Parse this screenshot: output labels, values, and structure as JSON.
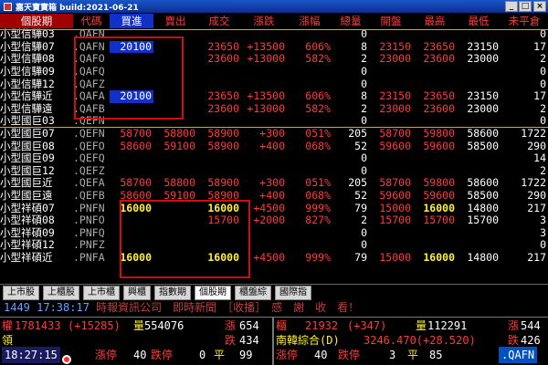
{
  "window": {
    "title": "嘉天寶寶箱 build:2021-06-21",
    "controls": [
      "_",
      "□",
      "×"
    ]
  },
  "colors": {
    "up": "#ff3b3b",
    "header_bg": "#a00000",
    "highlight_box": "#cc1010",
    "text_yellow": "#ffef3a"
  },
  "table": {
    "headers": [
      "個股期",
      "代碼",
      "買進",
      "賣出",
      "成交",
      "漲跌",
      "漲幅",
      "總量",
      "開盤",
      "最高",
      "最低",
      "未平倉"
    ],
    "rows": [
      [
        "小型信驊03",
        ".QAFN",
        "",
        "",
        "",
        "",
        "",
        "0",
        "",
        "",
        "",
        "0"
      ],
      [
        "小型信驊07",
        ".QAFN",
        "20100",
        "",
        "23650",
        "+13500",
        "606%",
        "8",
        "23150",
        "23650",
        "23150",
        "17"
      ],
      [
        "小型信驊08",
        ".QAFO",
        "",
        "",
        "23600",
        "+13000",
        "582%",
        "2",
        "23000",
        "23600",
        "23000",
        "2"
      ],
      [
        "小型信驊09",
        ".QAFQ",
        "",
        "",
        "",
        "",
        "",
        "0",
        "",
        "",
        "",
        "0"
      ],
      [
        "小型信驊12",
        ".QAFZ",
        "",
        "",
        "",
        "",
        "",
        "0",
        "",
        "",
        "",
        "0"
      ],
      [
        "小型信驊近",
        ".QAFA",
        "20100",
        "",
        "23650",
        "+13500",
        "606%",
        "8",
        "23150",
        "23650",
        "23150",
        "17"
      ],
      [
        "小型信驊遠",
        ".QAFB",
        "",
        "",
        "23600",
        "+13000",
        "582%",
        "2",
        "23000",
        "23600",
        "23000",
        "2"
      ],
      [
        "小型國巨03",
        ".QEFN",
        "",
        "",
        "",
        "",
        "",
        "0",
        "",
        "",
        "",
        "0"
      ],
      [
        "小型國巨07",
        ".QEFN",
        "58700",
        "58800",
        "58900",
        "+300",
        "051%",
        "205",
        "58700",
        "59800",
        "58600",
        "1722"
      ],
      [
        "小型國巨08",
        ".QEFO",
        "58600",
        "59100",
        "58900",
        "+400",
        "068%",
        "52",
        "59600",
        "59600",
        "58500",
        "290"
      ],
      [
        "小型國巨09",
        ".QEFQ",
        "",
        "",
        "",
        "",
        "",
        "0",
        "",
        "",
        "",
        "14"
      ],
      [
        "小型國巨12",
        ".QEFZ",
        "",
        "",
        "",
        "",
        "",
        "0",
        "",
        "",
        "",
        "2"
      ],
      [
        "小型國巨近",
        ".QEFA",
        "58700",
        "58800",
        "58900",
        "+300",
        "051%",
        "205",
        "58700",
        "59800",
        "58600",
        "1722"
      ],
      [
        "小型國巨遠",
        ".QEFB",
        "58600",
        "59100",
        "58900",
        "+400",
        "068%",
        "52",
        "59600",
        "59600",
        "58500",
        "290"
      ],
      [
        "小型祥碩07",
        ".PNFN",
        "16000",
        "",
        "16000",
        "+4500",
        "999%",
        "79",
        "15000",
        "16000",
        "14800",
        "217"
      ],
      [
        "小型祥碩08",
        ".PNFO",
        "",
        "",
        "15700",
        "+2000",
        "827%",
        "2",
        "15700",
        "15700",
        "15700",
        "3"
      ],
      [
        "小型祥碩09",
        ".PNFQ",
        "",
        "",
        "",
        "",
        "",
        "0",
        "",
        "",
        "",
        "3"
      ],
      [
        "小型祥碩12",
        ".PNFZ",
        "",
        "",
        "",
        "",
        "",
        "0",
        "",
        "",
        "",
        "0"
      ],
      [
        "小型祥碩近",
        ".PNFA",
        "16000",
        "",
        "16000",
        "+4500",
        "999%",
        "79",
        "15000",
        "16000",
        "14800",
        "217"
      ]
    ]
  },
  "tabs": [
    "上市股",
    "上櫃股",
    "上市櫃",
    "興櫃",
    "指數期",
    "個股期",
    "櫃盤綜",
    "國際指"
  ],
  "active_tab": "個股期",
  "ticker": {
    "time": "1449 17:38:17",
    "text": "時報資訊公司　即時新聞　［收播］　感　謝　收　看！"
  },
  "status": {
    "twse_label": "權",
    "twse_index": "1781433",
    "twse_change": "(+15285)",
    "twse_vol_label": "量",
    "twse_vol": "554076",
    "twse_up_label": "漲",
    "twse_up": "654",
    "twse_down_label": "跌",
    "twse_down": "434",
    "twse_sub": "領",
    "otc_label": "櫃",
    "otc_index": "21932",
    "otc_change": "(+347)",
    "otc_vol_label": "量",
    "otc_vol": "112291",
    "otc_up_label": "漲",
    "otc_up": "544",
    "otc_down_label": "跌",
    "otc_down": "426",
    "otc_sub": "南韓綜合(D)",
    "otc_sub_val": "3246.470(+28.520)",
    "clock": "18:27:15",
    "limit_up_label": "漲停",
    "limit_up": "40",
    "limit_down_label": "跌停",
    "limit_down": "0",
    "flat_label": "平",
    "flat": "99",
    "otc_limit_up_label": "漲停",
    "otc_limit_up": "40",
    "otc_limit_down_label": "跌停",
    "otc_limit_down": "3",
    "otc_flat_label": "平",
    "otc_flat": "85",
    "code": ".QAFN"
  }
}
